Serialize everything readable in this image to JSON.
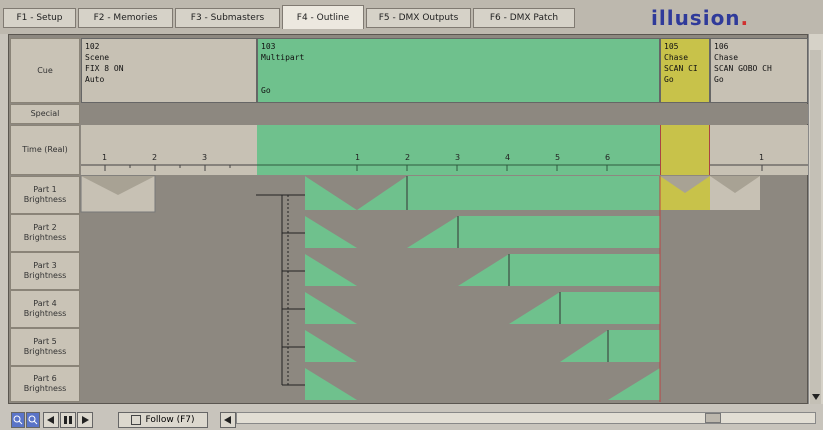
{
  "tabs": [
    {
      "label": "F1 - Setup"
    },
    {
      "label": "F2 - Memories"
    },
    {
      "label": "F3 - Submasters"
    },
    {
      "label": "F4 - Outline"
    },
    {
      "label": "F5 - DMX Outputs"
    },
    {
      "label": "F6 - DMX Patch"
    }
  ],
  "logo": "illusion.",
  "rows": {
    "cue": "Cue",
    "special": "Special",
    "time": "Time (Real)",
    "parts": [
      "Part 1 Brightness",
      "Part 2 Brightness",
      "Part 3 Brightness",
      "Part 4 Brightness",
      "Part 5 Brightness",
      "Part 6 Brightness"
    ]
  },
  "cues": [
    {
      "number": "102",
      "type": "Scene",
      "name": "FIX 8 ON",
      "mode": "Auto"
    },
    {
      "number": "103",
      "type": "Multipart",
      "name": "",
      "mode": "Go"
    },
    {
      "number": "105",
      "type": "Chase",
      "name": "SCAN CI",
      "mode": "Go"
    },
    {
      "number": "106",
      "type": "Chase",
      "name": "SCAN GOBO CH",
      "mode": "Go"
    }
  ],
  "time_ticks": {
    "cue102": [
      "1",
      "2",
      "3"
    ],
    "cue103": [
      "1",
      "2",
      "3",
      "4",
      "5",
      "6"
    ],
    "cue106": [
      "1"
    ]
  },
  "bottom": {
    "follow_label": "Follow (F7)"
  },
  "colors": {
    "green": "#6fc18d",
    "yellow": "#c8c24a",
    "gray": "#8d8880",
    "lightbg": "#c7c1b4"
  }
}
